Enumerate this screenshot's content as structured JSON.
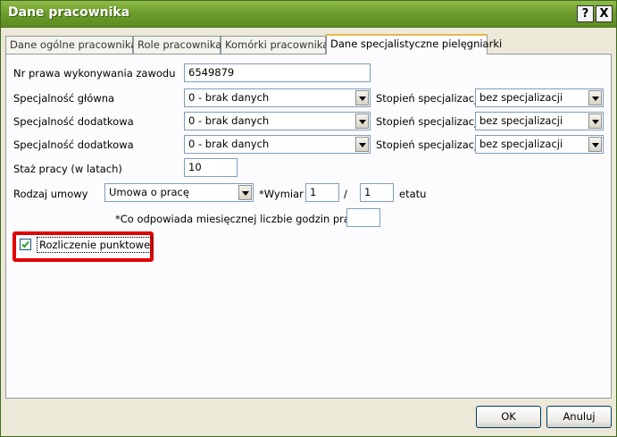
{
  "window": {
    "title": "Dane pracownika",
    "help_label": "?",
    "close_label": "X"
  },
  "tabs": [
    {
      "label": "Dane ogólne pracownika",
      "active": false
    },
    {
      "label": "Role pracownika",
      "active": false
    },
    {
      "label": "Komórki pracownika",
      "active": false
    },
    {
      "label": "Dane specjalistyczne pielęgniarki",
      "active": true
    }
  ],
  "form": {
    "license_label": "Nr prawa wykonywania zawodu",
    "license_value": "6549879",
    "spec_main_label": "Specjalność główna",
    "spec_main_value": "0 - brak danych",
    "spec_add1_label": "Specjalność dodatkowa",
    "spec_add1_value": "0 - brak danych",
    "spec_add2_label": "Specjalność dodatkowa",
    "spec_add2_value": "0 - brak danych",
    "degree_label": "Stopień specjalizacji",
    "degree1_value": "bez specjalizacji",
    "degree2_value": "bez specjalizacji",
    "degree3_value": "bez specjalizacji",
    "seniority_label": "Staż pracy (w latach)",
    "seniority_value": "10",
    "contract_label": "Rodzaj umowy",
    "contract_value": "Umowa o pracę",
    "dimension_label": "*Wymiar",
    "dimension_num": "1",
    "dimension_sep": "/",
    "dimension_den": "1",
    "dimension_unit": "etatu",
    "hours_label": "*Co odpowiada miesięcznej liczbie godzin pracy",
    "hours_value": "",
    "points_label": "Rozliczenie punktowe",
    "points_checked": true
  },
  "buttons": {
    "ok": "OK",
    "cancel": "Anuluj"
  },
  "colors": {
    "titlebar": "#6e9d2b",
    "highlight": "#e00000",
    "active_tab_accent": "#e6b94a"
  }
}
